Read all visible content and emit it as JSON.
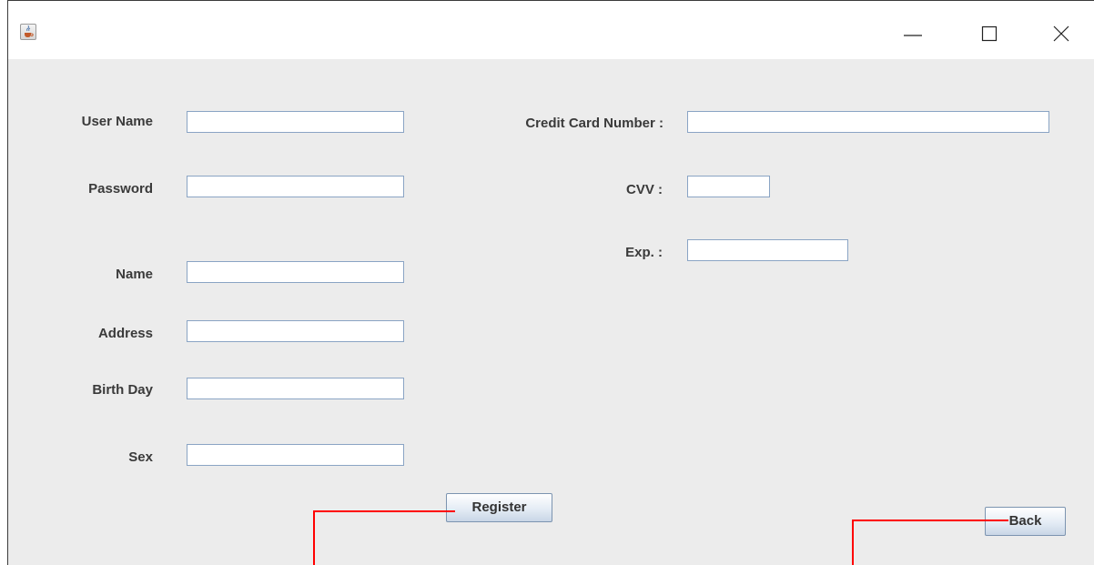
{
  "window": {
    "controls": [
      "minimize-icon",
      "maximize-icon",
      "close-icon"
    ],
    "app_icon": "java-cup-icon"
  },
  "form": {
    "username_label": "User Name",
    "password_label": "Password",
    "name_label": "Name",
    "address_label": "Address",
    "birthday_label": "Birth Day",
    "sex_label": "Sex",
    "card_number_label": "Credit Card Number :",
    "cvv_label": "CVV :",
    "exp_label": "Exp. :",
    "username_value": "",
    "password_value": "",
    "name_value": "",
    "address_value": "",
    "birthday_value": "",
    "sex_value": "",
    "card_number_value": "",
    "cvv_value": "",
    "exp_value": ""
  },
  "buttons": {
    "register_label": "Register",
    "back_label": "Back"
  },
  "colors": {
    "annotation": "#ff0000",
    "content_background": "#ececec"
  }
}
